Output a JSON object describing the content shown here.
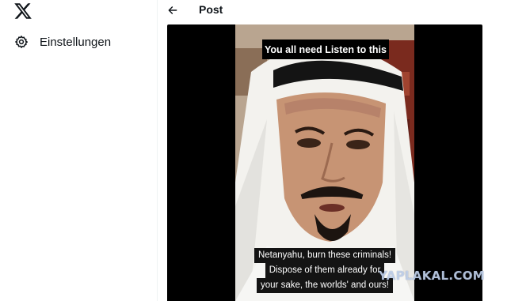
{
  "sidebar": {
    "logo_icon": "x-logo-icon",
    "items": [
      {
        "label": "Einstellungen",
        "icon": "gear-icon"
      }
    ]
  },
  "header": {
    "back_icon": "arrow-left-icon",
    "title": "Post"
  },
  "video": {
    "caption_top": "You all need Listen to this",
    "caption_bottom": [
      "Netanyahu, burn these criminals!",
      "Dispose of them already for",
      "your sake, the worlds' and ours!"
    ]
  },
  "watermark": "YAPLAKAL.COM",
  "colors": {
    "text": "#0f1419",
    "border": "#eff3f4",
    "video_bg": "#000000"
  }
}
